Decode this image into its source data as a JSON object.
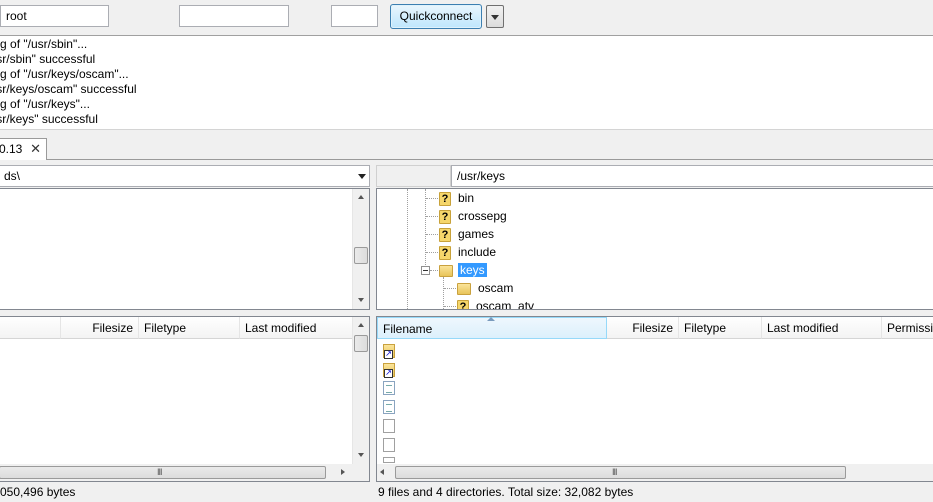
{
  "quickconnect": {
    "username": "root",
    "password": "",
    "port": "",
    "button_label": "Quickconnect"
  },
  "log": [
    "Listing of \"/usr/sbin\"...",
    "\"/usr/sbin\" successful",
    "Listing of \"/usr/keys/oscam\"...",
    "\"/usr/keys/oscam\" successful",
    "Listing of \"/usr/keys\"...",
    "\"/usr/keys\" successful"
  ],
  "tab": {
    "label": "0.13",
    "close": "✕"
  },
  "local": {
    "path": "ds\\",
    "columns": {
      "filename": "",
      "filesize": "Filesize",
      "filetype": "Filetype",
      "last_modified": "Last modified"
    },
    "status": "050,496 bytes",
    "grip": "III"
  },
  "remote": {
    "path": "/usr/keys",
    "tree": [
      {
        "label": "bin",
        "icon": "question-folder-icon"
      },
      {
        "label": "crossepg",
        "icon": "question-folder-icon"
      },
      {
        "label": "games",
        "icon": "question-folder-icon"
      },
      {
        "label": "include",
        "icon": "question-folder-icon"
      },
      {
        "label": "keys",
        "icon": "folder-icon",
        "selected": true
      },
      {
        "label": "oscam",
        "icon": "folder-icon"
      },
      {
        "label": "oscam_atv",
        "icon": "question-folder-icon"
      }
    ],
    "columns": {
      "filename": "Filename",
      "filesize": "Filesize",
      "filetype": "Filetype",
      "last_modified": "Last modified",
      "permissions": "Permissi"
    },
    "files": [
      "folder-link-icon",
      "folder-link-icon",
      "document-icon",
      "document-icon",
      "blank-file-icon",
      "blank-file-icon",
      "blank-file-icon"
    ],
    "status": "9 files and 4 directories. Total size: 32,082 bytes",
    "grip": "III"
  }
}
